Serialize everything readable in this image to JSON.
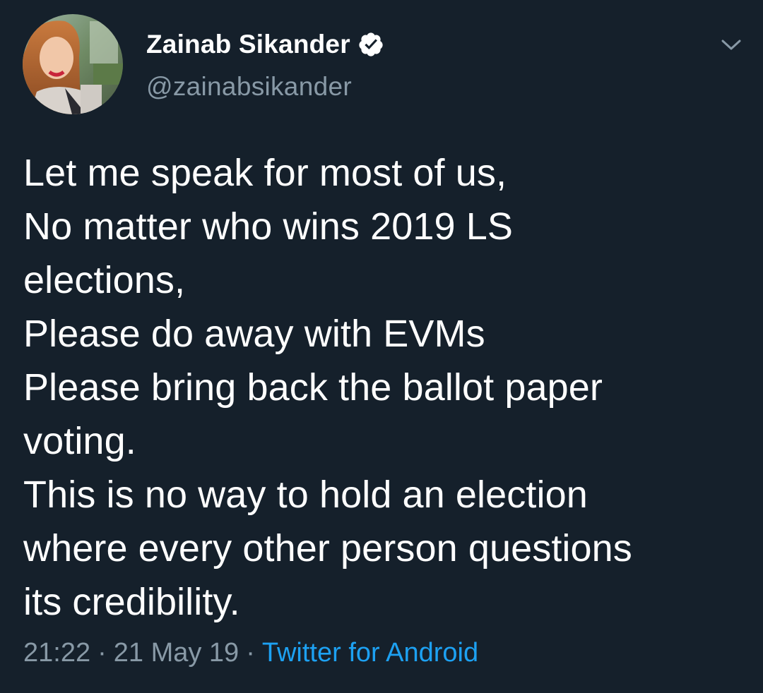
{
  "author": {
    "display_name": "Zainab Sikander",
    "handle": "@zainabsikander",
    "verified": true
  },
  "tweet": {
    "lines": [
      "Let me speak for most of us,",
      "No matter who wins 2019 LS",
      "elections,",
      "Please do away with EVMs",
      "Please bring back the ballot paper",
      "voting.",
      "This is no way to hold an election",
      "where every other person questions",
      "its credibility."
    ],
    "time": "21:22",
    "date": "21 May 19",
    "separator": "·",
    "source": "Twitter for Android"
  },
  "icons": {
    "verified": "verified-badge-icon",
    "menu": "chevron-down-icon"
  },
  "colors": {
    "background": "#15202b",
    "text": "#ffffff",
    "secondary_text": "#8899a6",
    "link": "#1da1f2"
  }
}
